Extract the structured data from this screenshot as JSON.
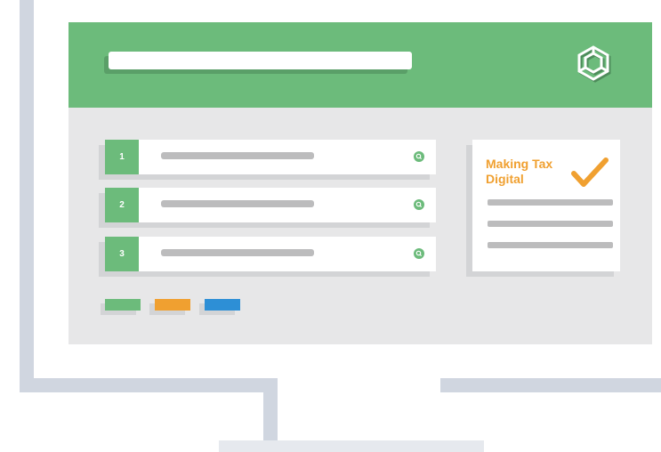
{
  "colors": {
    "header_green": "#6cbb7b",
    "accent_orange": "#f0a030",
    "accent_blue": "#2d8fd6",
    "frame_gray": "#d0d6e0",
    "screen_gray": "#e7e7e8"
  },
  "header": {
    "logo_icon": "hexagon-cube-logo-icon"
  },
  "list": {
    "items": [
      {
        "number": "1",
        "icon": "search-icon"
      },
      {
        "number": "2",
        "icon": "search-icon"
      },
      {
        "number": "3",
        "icon": "search-icon"
      }
    ]
  },
  "card": {
    "title": "Making Tax Digital",
    "icon": "checkmark-icon"
  },
  "swatches": [
    {
      "color": "#6cbb7b"
    },
    {
      "color": "#f0a030"
    },
    {
      "color": "#2d8fd6"
    }
  ]
}
